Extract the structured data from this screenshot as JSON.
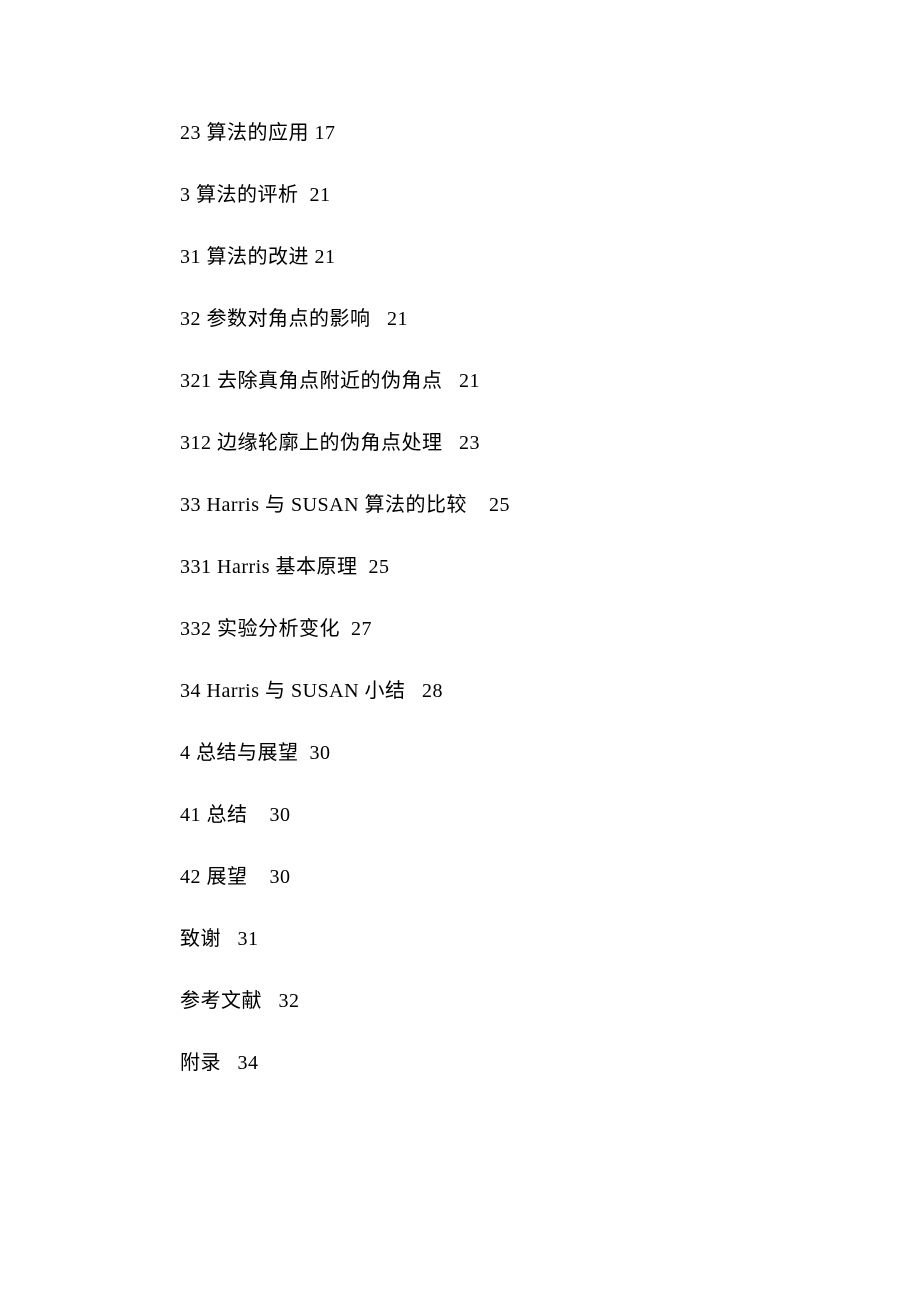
{
  "toc": [
    {
      "text": "23 算法的应用 17"
    },
    {
      "text": "3 算法的评析  21"
    },
    {
      "text": "31 算法的改进 21"
    },
    {
      "text": "32 参数对角点的影响   21"
    },
    {
      "text": "321 去除真角点附近的伪角点   21"
    },
    {
      "text": "312 边缘轮廓上的伪角点处理   23"
    },
    {
      "text": "33 Harris 与 SUSAN 算法的比较    25"
    },
    {
      "text": "331 Harris 基本原理  25"
    },
    {
      "text": "332 实验分析变化  27"
    },
    {
      "text": "34 Harris 与 SUSAN 小结   28"
    },
    {
      "text": "4 总结与展望  30"
    },
    {
      "text": "41 总结    30"
    },
    {
      "text": "42 展望    30"
    },
    {
      "text": "致谢   31"
    },
    {
      "text": "参考文献   32"
    },
    {
      "text": "附录   34"
    }
  ]
}
